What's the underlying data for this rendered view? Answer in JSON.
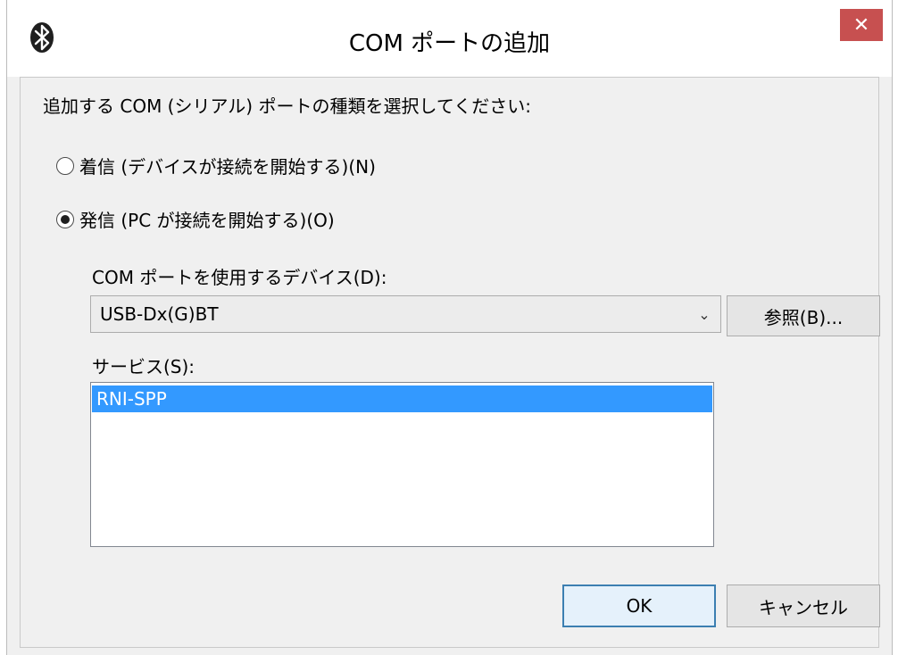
{
  "window": {
    "title": "COM ポートの追加",
    "close_label": "✕"
  },
  "dialog": {
    "prompt": "追加する COM (シリアル) ポートの種類を選択してください:",
    "radio_incoming": {
      "label": "着信 (デバイスが接続を開始する)(N)",
      "checked": false
    },
    "radio_outgoing": {
      "label": "発信 (PC が接続を開始する)(O)",
      "checked": true
    },
    "device_label": "COM ポートを使用するデバイス(D):",
    "device_value": "USB-Dx(G)BT",
    "browse_label": "参照(B)...",
    "services_label": "サービス(S):",
    "services": [
      "RNI-SPP"
    ],
    "ok_label": "OK",
    "cancel_label": "キャンセル"
  },
  "icons": {
    "app": "bluetooth-icon",
    "dropdown": "chevron-down-icon",
    "close": "close-icon"
  },
  "colors": {
    "selection": "#3399ff",
    "close_button": "#c75050",
    "default_button_border": "#3c7fb1"
  }
}
